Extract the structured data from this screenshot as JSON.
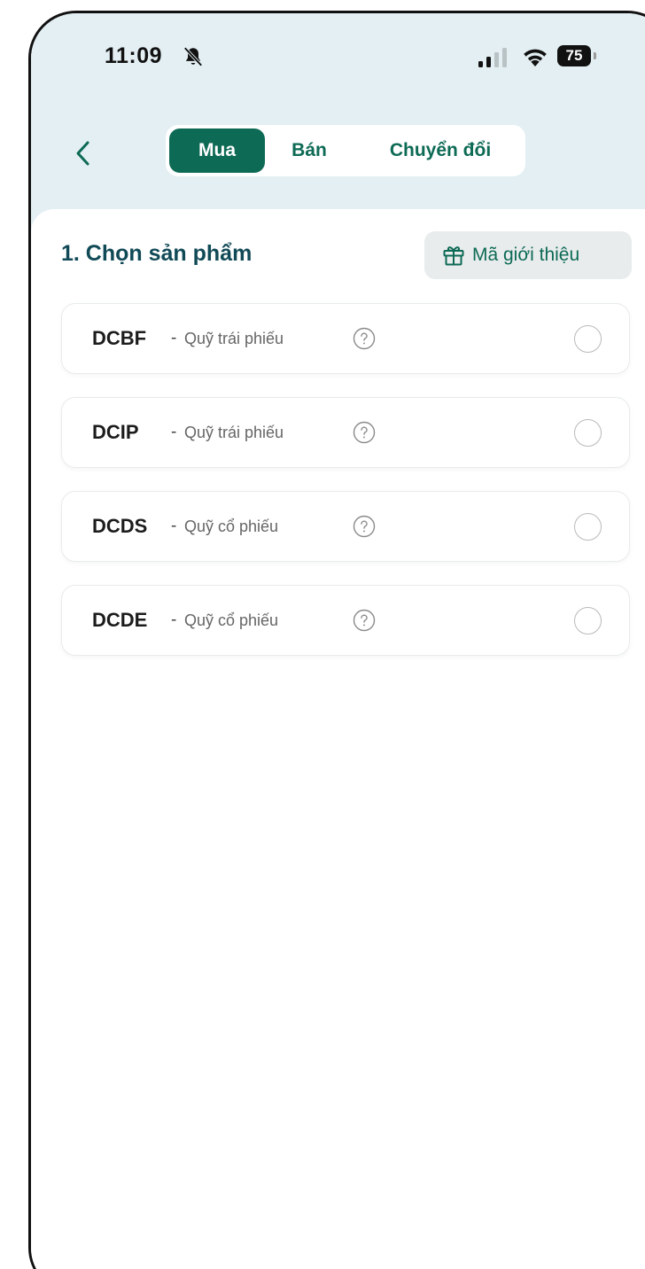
{
  "status_bar": {
    "time": "11:09",
    "battery": "75",
    "icons": [
      "bell-off-icon",
      "signal-icon",
      "wifi-icon",
      "battery-icon"
    ]
  },
  "header": {
    "back_icon": "chevron-left-icon",
    "tabs": [
      {
        "label": "Mua",
        "active": true
      },
      {
        "label": "Bán",
        "active": false
      },
      {
        "label": "Chuyển đổi",
        "active": false
      }
    ]
  },
  "section": {
    "title": "1. Chọn sản phẩm",
    "referral_label": "Mã giới thiệu",
    "referral_icon": "gift-icon"
  },
  "products": [
    {
      "code": "DCBF",
      "separator": "-",
      "type": "Quỹ trái phiếu",
      "selected": false
    },
    {
      "code": "DCIP",
      "separator": "-",
      "type": "Quỹ trái phiếu",
      "selected": false
    },
    {
      "code": "DCDS",
      "separator": "-",
      "type": "Quỹ cổ phiếu",
      "selected": false
    },
    {
      "code": "DCDE",
      "separator": "-",
      "type": "Quỹ cổ phiếu",
      "selected": false
    }
  ],
  "colors": {
    "accent": "#0d6a55",
    "title": "#114a57",
    "header_bg": "#e3eff3"
  }
}
